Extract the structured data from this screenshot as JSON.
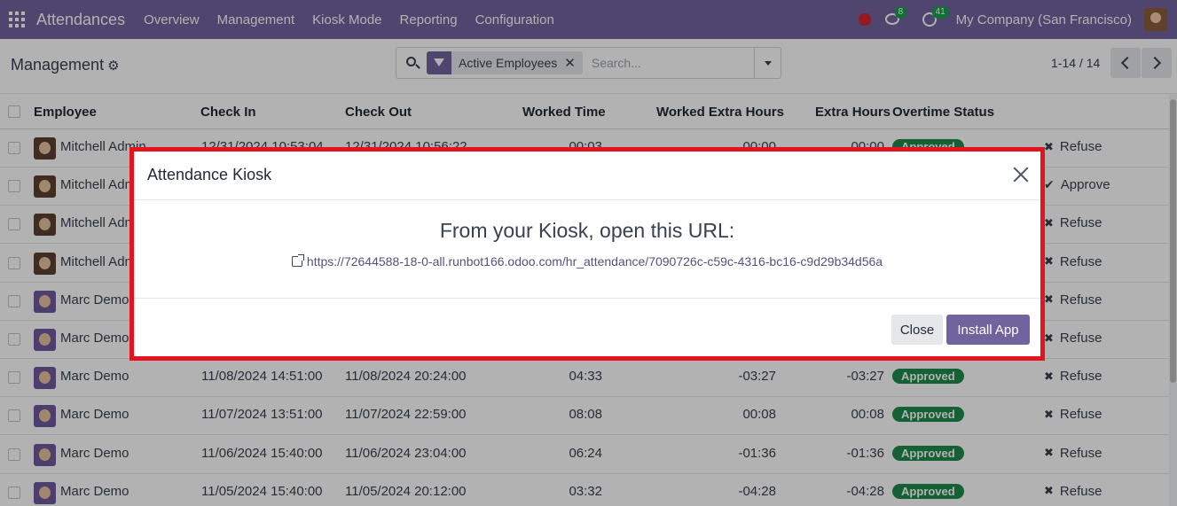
{
  "navbar": {
    "app_title": "Attendances",
    "menu": [
      "Overview",
      "Management",
      "Kiosk Mode",
      "Reporting",
      "Configuration"
    ],
    "messages_count": "8",
    "activities_count": "41",
    "company": "My Company (San Francisco)",
    "bg_color": "#71639e"
  },
  "control": {
    "breadcrumb": "Management",
    "gear_icon": "⚙",
    "facet_label": "Active Employees",
    "facet_close": "✕",
    "search_placeholder": "Search...",
    "pager": "1-14 / 14"
  },
  "table": {
    "headers": [
      "Employee",
      "Check In",
      "Check Out",
      "Worked Time",
      "Worked Extra Hours",
      "Extra Hours",
      "Overtime Status"
    ],
    "rows": [
      {
        "employee": "Mitchell Admin",
        "check_in": "12/31/2024 10:53:04",
        "check_out": "12/31/2024 10:56:22",
        "worked": "00:03",
        "worked_extra": "00:00",
        "extra": "00:00",
        "status": "Approved",
        "action": "Refuse"
      },
      {
        "employee": "Mitchell Admin",
        "check_in": "",
        "check_out": "",
        "worked": "",
        "worked_extra": "",
        "extra": "",
        "status": "",
        "action": "Approve"
      },
      {
        "employee": "Mitchell Admin",
        "check_in": "",
        "check_out": "",
        "worked": "",
        "worked_extra": "",
        "extra": "",
        "status": "",
        "action": "Refuse"
      },
      {
        "employee": "Mitchell Admin",
        "check_in": "",
        "check_out": "",
        "worked": "",
        "worked_extra": "",
        "extra": "",
        "status": "",
        "action": "Refuse"
      },
      {
        "employee": "Marc Demo",
        "check_in": "",
        "check_out": "",
        "worked": "",
        "worked_extra": "",
        "extra": "",
        "status": "",
        "action": "Refuse"
      },
      {
        "employee": "Marc Demo",
        "check_in": "",
        "check_out": "",
        "worked": "",
        "worked_extra": "",
        "extra": "",
        "status": "",
        "action": "Refuse"
      },
      {
        "employee": "Marc Demo",
        "check_in": "11/08/2024 14:51:00",
        "check_out": "11/08/2024 20:24:00",
        "worked": "04:33",
        "worked_extra": "-03:27",
        "extra": "-03:27",
        "status": "Approved",
        "action": "Refuse"
      },
      {
        "employee": "Marc Demo",
        "check_in": "11/07/2024 13:51:00",
        "check_out": "11/07/2024 22:59:00",
        "worked": "08:08",
        "worked_extra": "00:08",
        "extra": "00:08",
        "status": "Approved",
        "action": "Refuse"
      },
      {
        "employee": "Marc Demo",
        "check_in": "11/06/2024 15:40:00",
        "check_out": "11/06/2024 23:04:00",
        "worked": "06:24",
        "worked_extra": "-01:36",
        "extra": "-01:36",
        "status": "Approved",
        "action": "Refuse"
      },
      {
        "employee": "Marc Demo",
        "check_in": "11/05/2024 15:40:00",
        "check_out": "11/05/2024 20:12:00",
        "worked": "03:32",
        "worked_extra": "-04:28",
        "extra": "-04:28",
        "status": "Approved",
        "action": "Refuse"
      }
    ]
  },
  "dialog": {
    "title": "Attendance Kiosk",
    "heading": "From your Kiosk, open this URL:",
    "url": "https://72644588-18-0-all.runbot166.odoo.com/hr_attendance/7090726c-c59c-4316-bc16-c9d29b34d56a",
    "close_label": "Close",
    "install_label": "Install App",
    "highlight_color": "#e5131d"
  }
}
